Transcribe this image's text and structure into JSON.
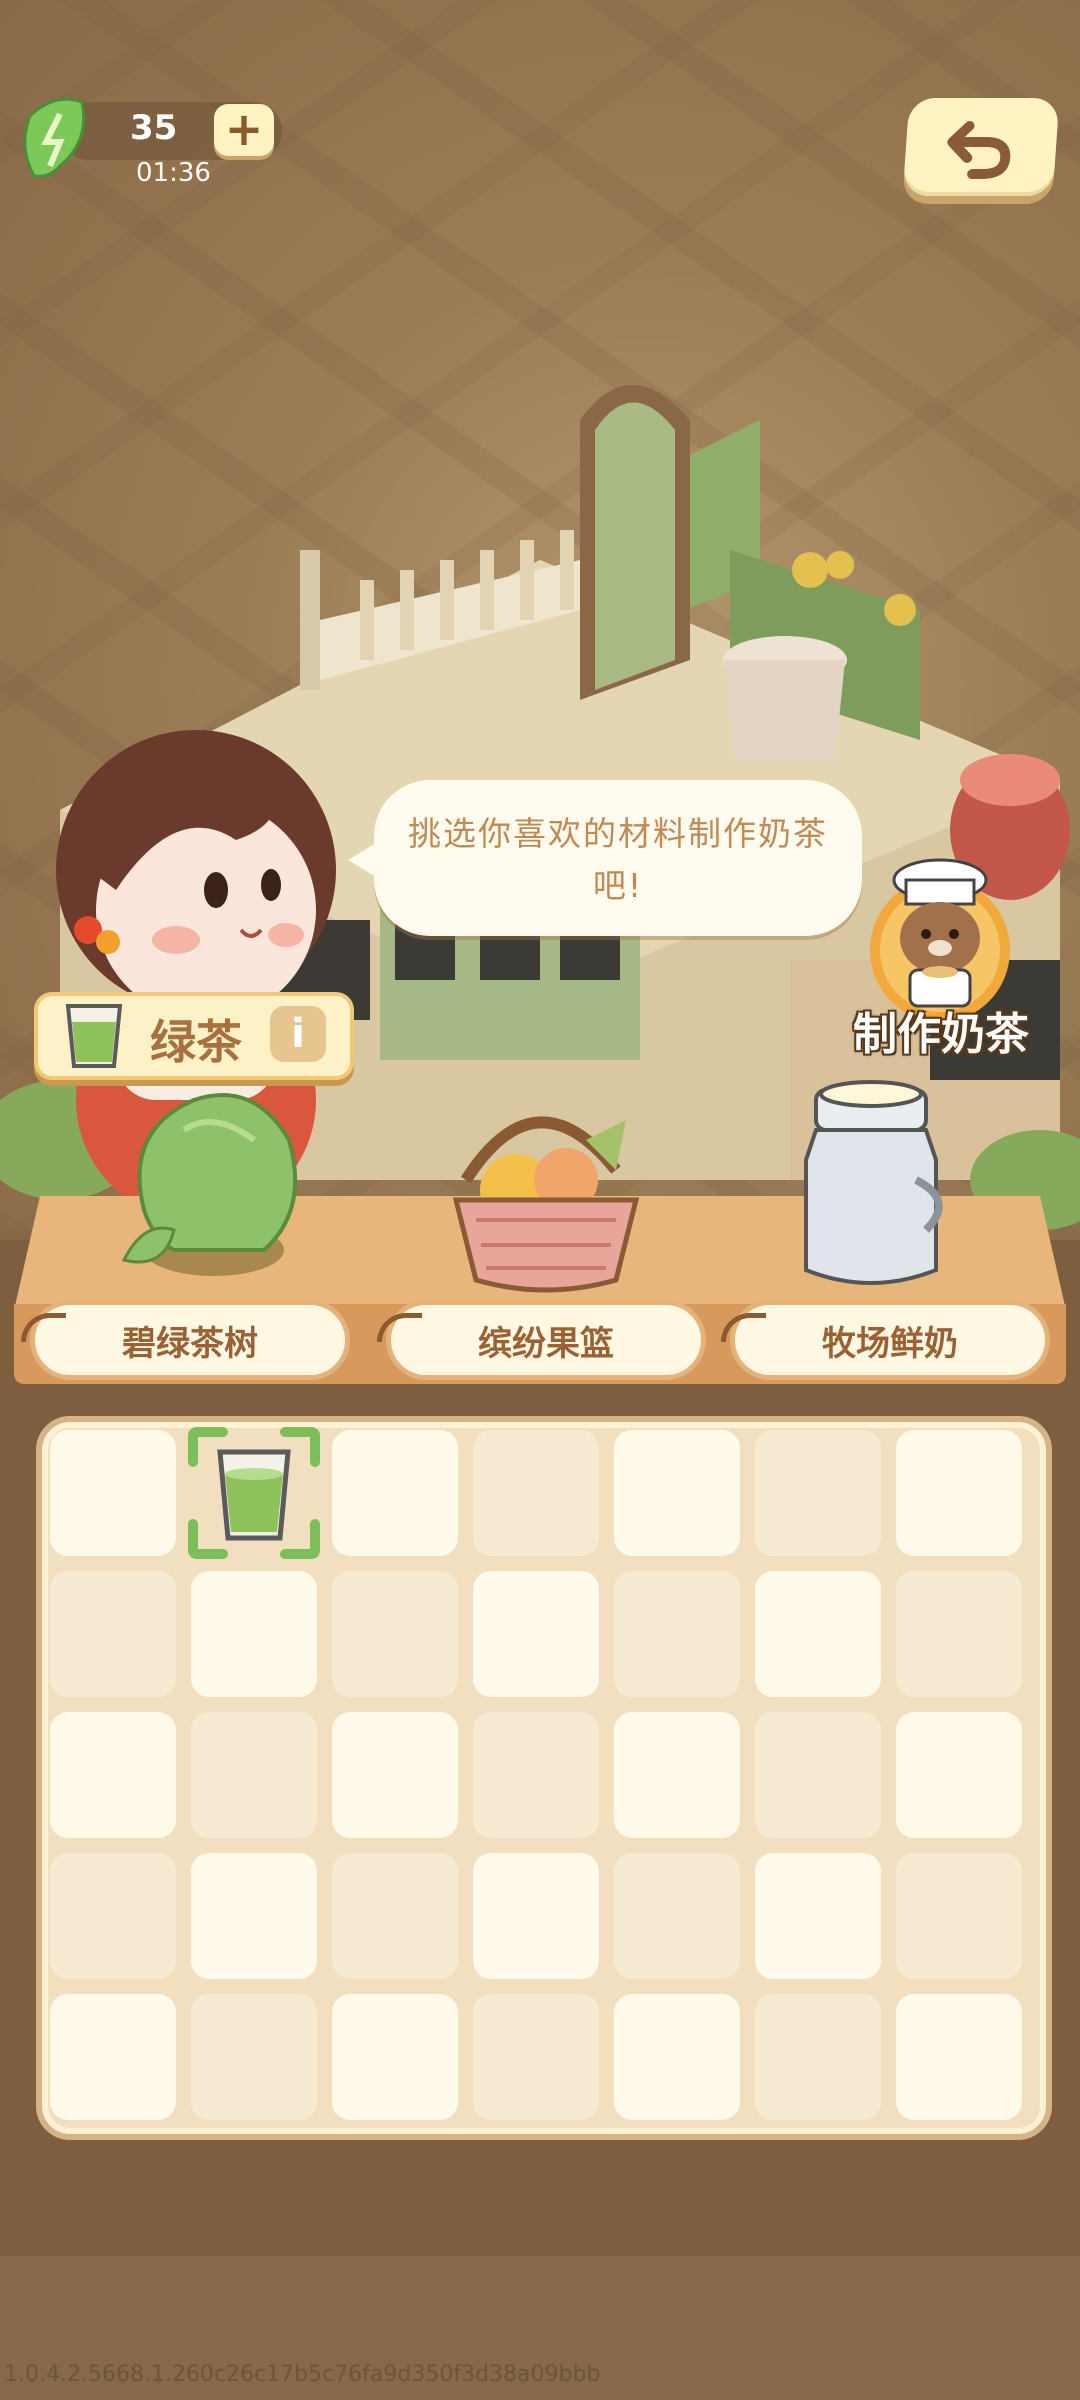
{
  "energy": {
    "count": "35",
    "timer": "01:36",
    "plus_label": "+"
  },
  "back_button": {
    "icon": "undo-arrow-icon"
  },
  "speech_bubble": {
    "text": "挑选你喜欢的材料制作奶茶吧!"
  },
  "make_button": {
    "label": "制作奶茶"
  },
  "selected_item": {
    "name": "绿茶",
    "info_label": "i"
  },
  "sources": [
    {
      "label": "碧绿茶树",
      "icon": "tea-tree-icon"
    },
    {
      "label": "缤纷果篮",
      "icon": "fruit-basket-icon"
    },
    {
      "label": "牧场鲜奶",
      "icon": "milk-can-icon"
    }
  ],
  "inventory": {
    "columns": 7,
    "rows": 5,
    "items": [
      {
        "row": 0,
        "col": 1,
        "icon": "green-tea-cup-icon",
        "selected": true
      }
    ]
  },
  "version": "1.0.4.2.5668.1.260c26c17b5c76fa9d350f3d38a09bbb",
  "colors": {
    "accent": "#7cbf5a",
    "panel": "#f1dfbf",
    "shelf": "#e8b67b"
  }
}
